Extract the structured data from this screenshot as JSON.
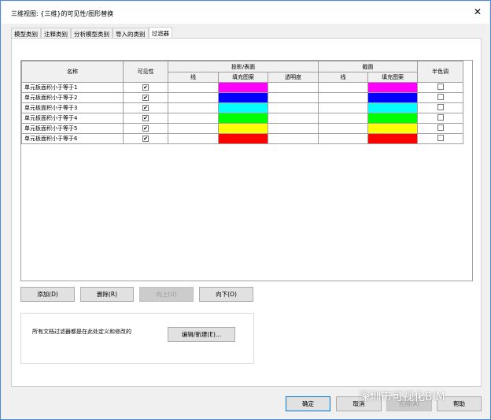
{
  "window": {
    "title": "三维视图: {三维}的可见性/图形替换",
    "close": "✕"
  },
  "tabs": [
    "模型类别",
    "注释类别",
    "分析模型类别",
    "导入的类别",
    "过滤器"
  ],
  "table": {
    "headers": {
      "name": "名称",
      "visibility": "可见性",
      "projection": "投影/表面",
      "cut": "截面",
      "halftone": "半色调",
      "line": "线",
      "fill": "填充图案",
      "transparency": "透明度"
    },
    "rows": [
      {
        "name": "单元板面积小于等于1",
        "visible": "✔",
        "color": "#ff00ff"
      },
      {
        "name": "单元板面积小于等于2",
        "visible": "✔",
        "color": "#0000ff"
      },
      {
        "name": "单元板面积小于等于3",
        "visible": "✔",
        "color": "#00ffff"
      },
      {
        "name": "单元板面积小于等于4",
        "visible": "✔",
        "color": "#00ff00"
      },
      {
        "name": "单元板面积小于等于5",
        "visible": "✔",
        "color": "#ffff00"
      },
      {
        "name": "单元板面积小于等于6",
        "visible": "✔",
        "color": "#ff0000"
      }
    ]
  },
  "buttons": {
    "add": "添加(D)",
    "delete": "删除(R)",
    "up": "向上(U)",
    "down": "向下(O)",
    "edit": "编辑/新建(E)...",
    "ok": "确定",
    "cancel": "取消",
    "apply": "应用(A)",
    "help": "帮助"
  },
  "group_text": "所有文档过滤器都是在此处定义和修改的",
  "watermark": "深圳市可视化BIM"
}
